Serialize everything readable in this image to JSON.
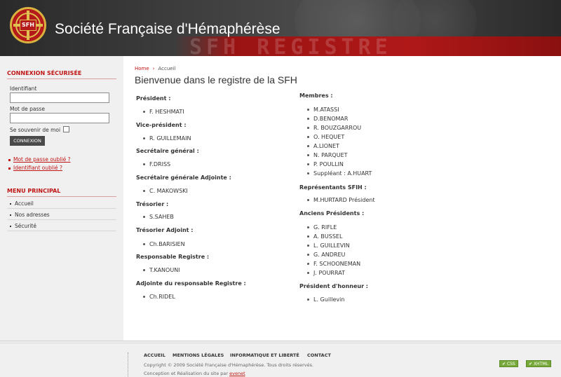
{
  "header": {
    "site_title": "Société Française d'Hémaphérèse",
    "logo_text": "SFH",
    "banner_text": "SFH REGISTRE"
  },
  "sidebar": {
    "login_heading": "CONNEXION SÉCURISÉE",
    "username_label": "Identifiant",
    "username_value": "",
    "password_label": "Mot de passe",
    "password_value": "",
    "remember_label": "Se souvenir de moi",
    "connect_button": "CONNEXION",
    "forgot_password": "Mot de passe oublié ?",
    "forgot_username": "Identifiant oublié ?",
    "menu_heading": "MENU PRINCIPAL",
    "menu_items": [
      "Accueil",
      "Nos adresses",
      "Sécurité"
    ]
  },
  "breadcrumb": {
    "home": "Home",
    "current": "Accueil"
  },
  "page_title": "Bienvenue dans le registre de la SFH",
  "left_column": [
    {
      "role": "Président :",
      "people": [
        "F. HESHMATI"
      ]
    },
    {
      "role": "Vice-président :",
      "people": [
        "R. GUILLEMAIN"
      ]
    },
    {
      "role": "Secrétaire général :",
      "people": [
        "F.DRISS"
      ]
    },
    {
      "role": "Secrétaire générale Adjointe :",
      "people": [
        "C. MAKOWSKI"
      ]
    },
    {
      "role": "Trésorier :",
      "people": [
        "S.SAHEB"
      ]
    },
    {
      "role": "Trésorier Adjoint :",
      "people": [
        "Ch.BARISIEN"
      ]
    },
    {
      "role": "Responsable Registre :",
      "people": [
        "T.KANOUNI"
      ]
    },
    {
      "role": "Adjointe du responsable Registre :",
      "people": [
        "Ch.RIDEL"
      ]
    }
  ],
  "right_column": [
    {
      "role": "Membres :",
      "people": [
        "M.ATASSI",
        "D.BENOMAR",
        "R. BOUZGARROU",
        "O. HEQUET",
        "A.LIONET",
        "N. PARQUET",
        "P. POULLIN",
        "Suppléant : A.HUART"
      ]
    },
    {
      "role": "Représentants SFIH :",
      "people": [
        "M.HURTARD Président"
      ]
    },
    {
      "role": "Anciens Présidents :",
      "people": [
        "G. RIFLE",
        "A. BUSSEL",
        "L. GUILLEVIN",
        "G. ANDREU",
        "F. SCHOONEMAN",
        "J. POURRAT"
      ]
    },
    {
      "role": "Président d'honneur :",
      "people": [
        "L. Guillevin"
      ]
    }
  ],
  "footer": {
    "nav": [
      "ACCUEIL",
      "MENTIONS LÉGALES",
      "INFORMATIQUE ET LIBERTÉ",
      "CONTACT"
    ],
    "copyright": "Copyright © 2009 Société Française d'Hémaphérèse. Tous droits réservés.",
    "credit_prefix": "Conception et Réalisation du site par",
    "credit_link": "evenet",
    "badges": [
      "CSS",
      "XHTML"
    ]
  },
  "colors": {
    "accent": "#c01414",
    "header": "#2a2a2a",
    "badge": "#77a83a"
  }
}
